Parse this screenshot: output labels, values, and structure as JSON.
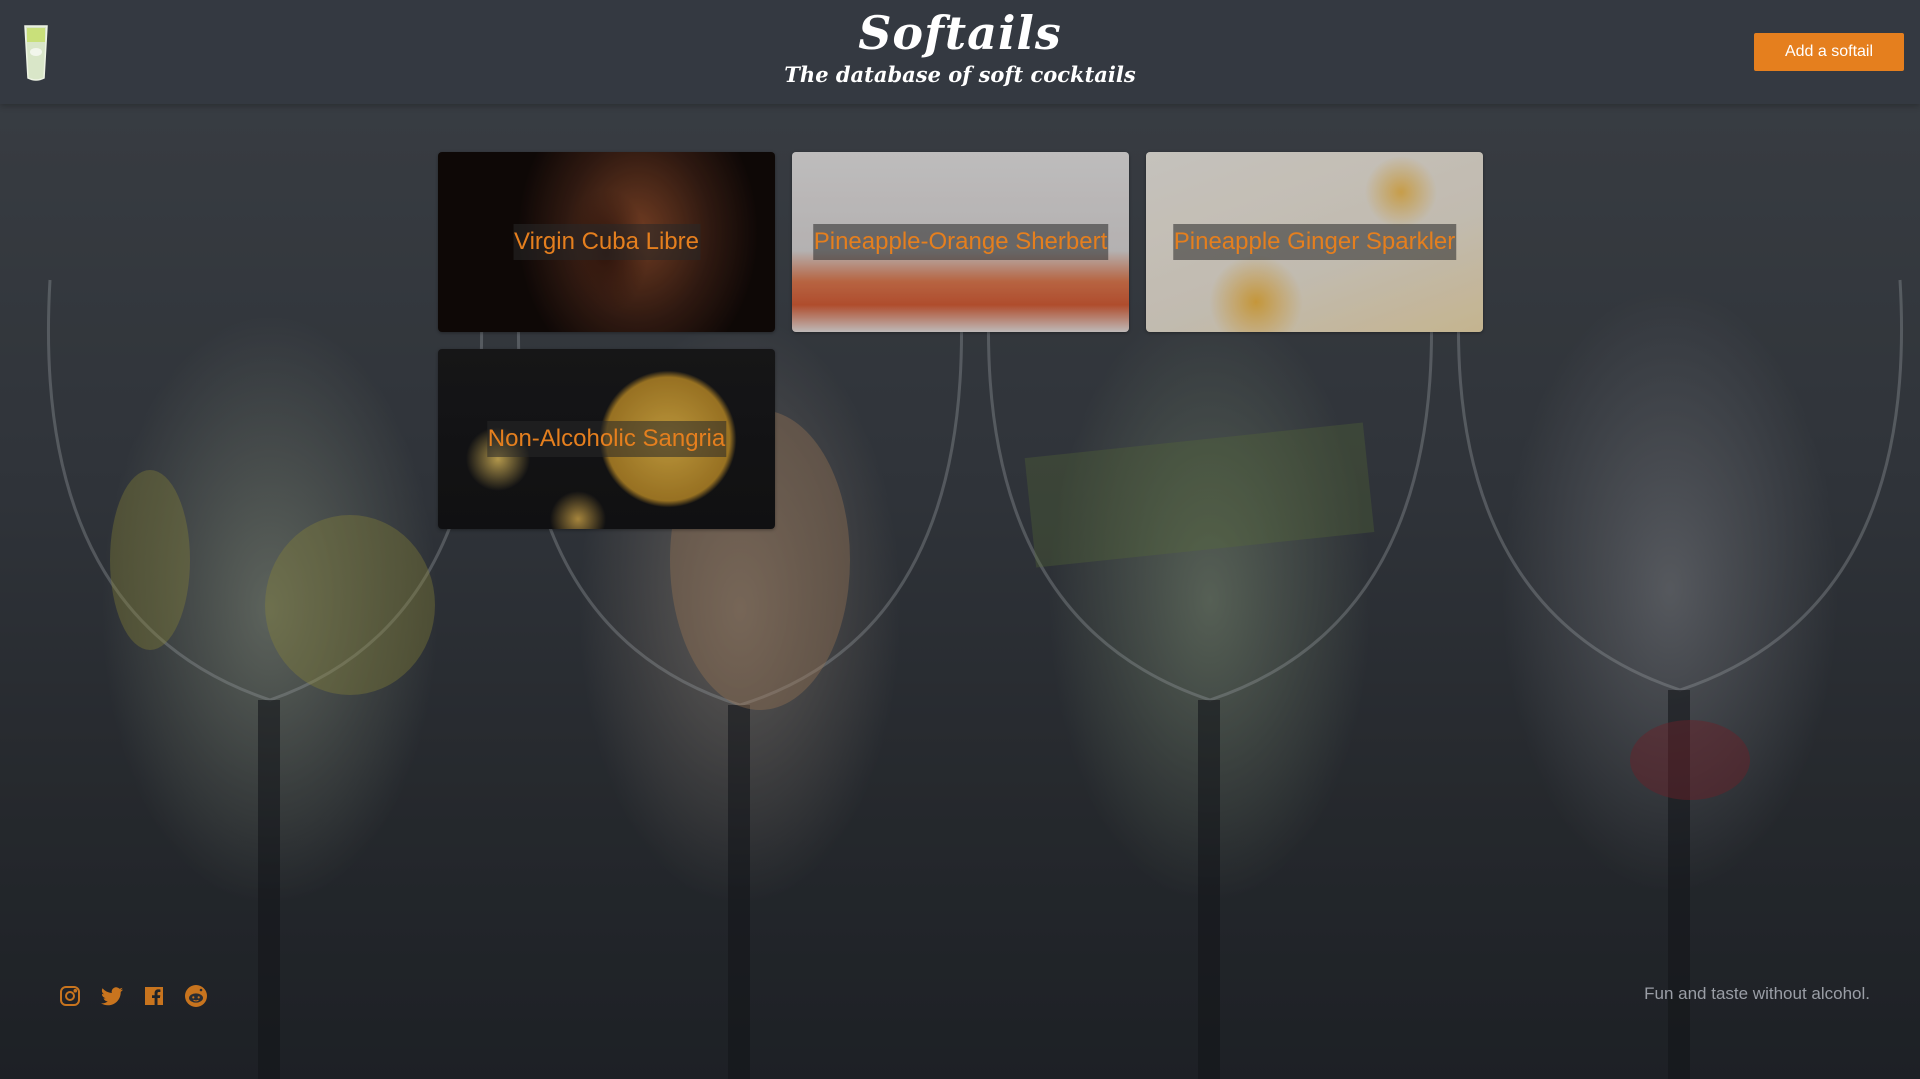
{
  "header": {
    "title": "Softails",
    "subtitle": "The database of soft cocktails",
    "add_button_label": "Add a softail"
  },
  "cards": [
    {
      "title": "Virgin Cuba Libre"
    },
    {
      "title": "Pineapple-Orange Sherbert"
    },
    {
      "title": "Pineapple Ginger Sparkler"
    },
    {
      "title": "Non-Alcoholic Sangria"
    }
  ],
  "footer": {
    "social_icons": [
      "instagram-icon",
      "twitter-icon",
      "facebook-icon",
      "reddit-icon"
    ],
    "tagline": "Fun and taste without alcohol."
  },
  "colors": {
    "accent": "#e57f1e",
    "header_bg": "#343942",
    "text_light": "#ffffff",
    "footer_text": "#9a9ea6"
  }
}
